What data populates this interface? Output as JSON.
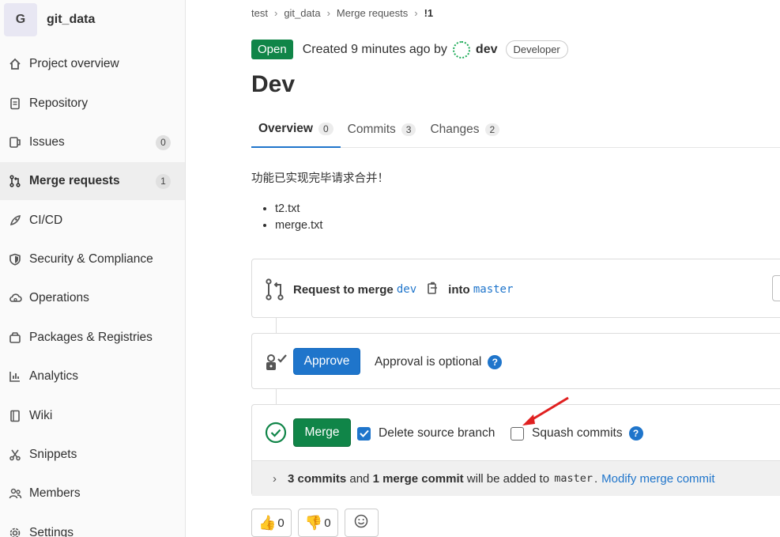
{
  "project": {
    "avatar_letter": "G",
    "name": "git_data"
  },
  "sidebar": {
    "items": [
      {
        "label": "Project overview",
        "icon": "home-icon"
      },
      {
        "label": "Repository",
        "icon": "doc-icon"
      },
      {
        "label": "Issues",
        "icon": "issues-icon",
        "badge": "0"
      },
      {
        "label": "Merge requests",
        "icon": "merge-request-icon",
        "badge": "1",
        "active": true
      },
      {
        "label": "CI/CD",
        "icon": "rocket-icon"
      },
      {
        "label": "Security & Compliance",
        "icon": "shield-icon"
      },
      {
        "label": "Operations",
        "icon": "cloud-icon"
      },
      {
        "label": "Packages & Registries",
        "icon": "package-icon"
      },
      {
        "label": "Analytics",
        "icon": "chart-icon"
      },
      {
        "label": "Wiki",
        "icon": "book-icon"
      },
      {
        "label": "Snippets",
        "icon": "scissors-icon"
      },
      {
        "label": "Members",
        "icon": "users-icon"
      },
      {
        "label": "Settings",
        "icon": "gear-icon"
      }
    ]
  },
  "breadcrumb": {
    "items": [
      "test",
      "git_data",
      "Merge requests",
      "!1"
    ]
  },
  "mr": {
    "status": "Open",
    "created_text": "Created 9 minutes ago by",
    "author": "dev",
    "role": "Developer",
    "title": "Dev"
  },
  "tabs": [
    {
      "label": "Overview",
      "count": "0"
    },
    {
      "label": "Commits",
      "count": "3"
    },
    {
      "label": "Changes",
      "count": "2"
    }
  ],
  "description": {
    "text": "功能已实现完毕请求合并！",
    "files": [
      "t2.txt",
      "merge.txt"
    ]
  },
  "request": {
    "prefix": "Request to merge",
    "source": "dev",
    "into": "into",
    "target": "master"
  },
  "approval": {
    "button": "Approve",
    "text": "Approval is optional"
  },
  "merge": {
    "button": "Merge",
    "delete_source": "Delete source branch",
    "squash": "Squash commits",
    "commits_bold": "3 commits",
    "and": "and",
    "merge_commit_bold": "1 merge commit",
    "will_be_added": "will be added to",
    "target": "master",
    "period": ".",
    "modify_link": "Modify merge commit"
  },
  "reactions": {
    "thumbs_up_count": "0",
    "thumbs_down_count": "0"
  },
  "colors": {
    "accent_blue": "#1f75cb",
    "success_green": "#108548",
    "arrow_red": "#e02020"
  }
}
